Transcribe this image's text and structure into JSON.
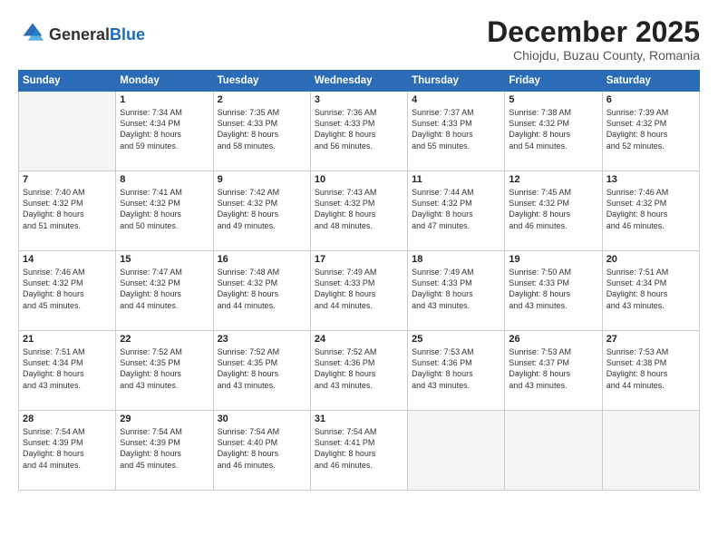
{
  "logo": {
    "general": "General",
    "blue": "Blue"
  },
  "title": "December 2025",
  "subtitle": "Chiojdu, Buzau County, Romania",
  "days_of_week": [
    "Sunday",
    "Monday",
    "Tuesday",
    "Wednesday",
    "Thursday",
    "Friday",
    "Saturday"
  ],
  "weeks": [
    [
      {
        "day": "",
        "info": ""
      },
      {
        "day": "1",
        "info": "Sunrise: 7:34 AM\nSunset: 4:34 PM\nDaylight: 8 hours\nand 59 minutes."
      },
      {
        "day": "2",
        "info": "Sunrise: 7:35 AM\nSunset: 4:33 PM\nDaylight: 8 hours\nand 58 minutes."
      },
      {
        "day": "3",
        "info": "Sunrise: 7:36 AM\nSunset: 4:33 PM\nDaylight: 8 hours\nand 56 minutes."
      },
      {
        "day": "4",
        "info": "Sunrise: 7:37 AM\nSunset: 4:33 PM\nDaylight: 8 hours\nand 55 minutes."
      },
      {
        "day": "5",
        "info": "Sunrise: 7:38 AM\nSunset: 4:32 PM\nDaylight: 8 hours\nand 54 minutes."
      },
      {
        "day": "6",
        "info": "Sunrise: 7:39 AM\nSunset: 4:32 PM\nDaylight: 8 hours\nand 52 minutes."
      }
    ],
    [
      {
        "day": "7",
        "info": "Sunrise: 7:40 AM\nSunset: 4:32 PM\nDaylight: 8 hours\nand 51 minutes."
      },
      {
        "day": "8",
        "info": "Sunrise: 7:41 AM\nSunset: 4:32 PM\nDaylight: 8 hours\nand 50 minutes."
      },
      {
        "day": "9",
        "info": "Sunrise: 7:42 AM\nSunset: 4:32 PM\nDaylight: 8 hours\nand 49 minutes."
      },
      {
        "day": "10",
        "info": "Sunrise: 7:43 AM\nSunset: 4:32 PM\nDaylight: 8 hours\nand 48 minutes."
      },
      {
        "day": "11",
        "info": "Sunrise: 7:44 AM\nSunset: 4:32 PM\nDaylight: 8 hours\nand 47 minutes."
      },
      {
        "day": "12",
        "info": "Sunrise: 7:45 AM\nSunset: 4:32 PM\nDaylight: 8 hours\nand 46 minutes."
      },
      {
        "day": "13",
        "info": "Sunrise: 7:46 AM\nSunset: 4:32 PM\nDaylight: 8 hours\nand 46 minutes."
      }
    ],
    [
      {
        "day": "14",
        "info": "Sunrise: 7:46 AM\nSunset: 4:32 PM\nDaylight: 8 hours\nand 45 minutes."
      },
      {
        "day": "15",
        "info": "Sunrise: 7:47 AM\nSunset: 4:32 PM\nDaylight: 8 hours\nand 44 minutes."
      },
      {
        "day": "16",
        "info": "Sunrise: 7:48 AM\nSunset: 4:32 PM\nDaylight: 8 hours\nand 44 minutes."
      },
      {
        "day": "17",
        "info": "Sunrise: 7:49 AM\nSunset: 4:33 PM\nDaylight: 8 hours\nand 44 minutes."
      },
      {
        "day": "18",
        "info": "Sunrise: 7:49 AM\nSunset: 4:33 PM\nDaylight: 8 hours\nand 43 minutes."
      },
      {
        "day": "19",
        "info": "Sunrise: 7:50 AM\nSunset: 4:33 PM\nDaylight: 8 hours\nand 43 minutes."
      },
      {
        "day": "20",
        "info": "Sunrise: 7:51 AM\nSunset: 4:34 PM\nDaylight: 8 hours\nand 43 minutes."
      }
    ],
    [
      {
        "day": "21",
        "info": "Sunrise: 7:51 AM\nSunset: 4:34 PM\nDaylight: 8 hours\nand 43 minutes."
      },
      {
        "day": "22",
        "info": "Sunrise: 7:52 AM\nSunset: 4:35 PM\nDaylight: 8 hours\nand 43 minutes."
      },
      {
        "day": "23",
        "info": "Sunrise: 7:52 AM\nSunset: 4:35 PM\nDaylight: 8 hours\nand 43 minutes."
      },
      {
        "day": "24",
        "info": "Sunrise: 7:52 AM\nSunset: 4:36 PM\nDaylight: 8 hours\nand 43 minutes."
      },
      {
        "day": "25",
        "info": "Sunrise: 7:53 AM\nSunset: 4:36 PM\nDaylight: 8 hours\nand 43 minutes."
      },
      {
        "day": "26",
        "info": "Sunrise: 7:53 AM\nSunset: 4:37 PM\nDaylight: 8 hours\nand 43 minutes."
      },
      {
        "day": "27",
        "info": "Sunrise: 7:53 AM\nSunset: 4:38 PM\nDaylight: 8 hours\nand 44 minutes."
      }
    ],
    [
      {
        "day": "28",
        "info": "Sunrise: 7:54 AM\nSunset: 4:39 PM\nDaylight: 8 hours\nand 44 minutes."
      },
      {
        "day": "29",
        "info": "Sunrise: 7:54 AM\nSunset: 4:39 PM\nDaylight: 8 hours\nand 45 minutes."
      },
      {
        "day": "30",
        "info": "Sunrise: 7:54 AM\nSunset: 4:40 PM\nDaylight: 8 hours\nand 46 minutes."
      },
      {
        "day": "31",
        "info": "Sunrise: 7:54 AM\nSunset: 4:41 PM\nDaylight: 8 hours\nand 46 minutes."
      },
      {
        "day": "",
        "info": ""
      },
      {
        "day": "",
        "info": ""
      },
      {
        "day": "",
        "info": ""
      }
    ]
  ]
}
